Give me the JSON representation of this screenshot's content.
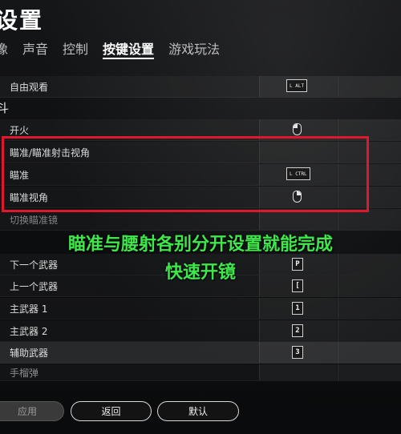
{
  "title": "设置",
  "tabs": [
    {
      "label": "像",
      "active": false
    },
    {
      "label": "声音",
      "active": false
    },
    {
      "label": "控制",
      "active": false
    },
    {
      "label": "按键设置",
      "active": true
    },
    {
      "label": "游戏玩法",
      "active": false
    }
  ],
  "section_label": "斗",
  "rows": {
    "free_look": {
      "label": "自由观看",
      "key": "L ALT"
    },
    "fire": {
      "label": "开火",
      "mouse": "left-mouse-button"
    },
    "aim_sight": {
      "label": "瞄准/瞄准射击视角"
    },
    "aim": {
      "label": "瞄准",
      "key": "L CTRL"
    },
    "aim_view": {
      "label": "瞄准视角",
      "mouse": "right-mouse-button"
    },
    "switch_sight": {
      "label": "切换瞄准镜"
    },
    "next_weapon": {
      "label": "下一个武器",
      "key": "P"
    },
    "prev_weapon": {
      "label": "上一个武器",
      "key": "["
    },
    "primary1": {
      "label": "主武器 1",
      "key": "1"
    },
    "primary2": {
      "label": "主武器 2",
      "key": "2"
    },
    "secondary": {
      "label": "辅助武器",
      "key": "3"
    },
    "throwable": {
      "label": "手榴弹"
    }
  },
  "overlay": {
    "line1": "瞄准与腰射各别分开设置就能完成",
    "line2": "快速开镜"
  },
  "buttons": {
    "apply": "应用",
    "back": "返回",
    "default": "默认"
  },
  "colors": {
    "highlight_box": "#e0182d",
    "overlay_text": "#3ee84a"
  }
}
